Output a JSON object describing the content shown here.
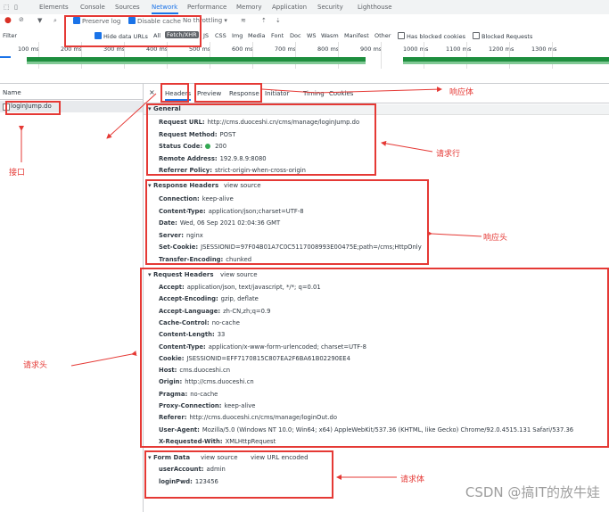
{
  "top_tabs": [
    "Elements",
    "Console",
    "Sources",
    "Network",
    "Performance",
    "Memory",
    "Application",
    "Security",
    "Lighthouse"
  ],
  "active_top_tab": "Network",
  "toolbar": {
    "preserve_log": "Preserve log",
    "disable_cache": "Disable cache",
    "throttling": "No throttling"
  },
  "filter": {
    "label": "Filter",
    "hide_data_urls": "Hide data URLs",
    "types": [
      "All",
      "Fetch/XHR",
      "JS",
      "CSS",
      "Img",
      "Media",
      "Font",
      "Doc",
      "WS",
      "Wasm",
      "Manifest",
      "Other"
    ],
    "selected_type": "Fetch/XHR",
    "blocked_cookies": "Has blocked cookies",
    "blocked_requests": "Blocked Requests"
  },
  "timeline_ticks": [
    "100 ms",
    "200 ms",
    "300 ms",
    "400 ms",
    "500 ms",
    "600 ms",
    "700 ms",
    "800 ms",
    "900 ms",
    "1000 ms",
    "1100 ms",
    "1200 ms",
    "1300 ms"
  ],
  "name_column": {
    "header": "Name",
    "request": "loginJump.do"
  },
  "detail_tabs": [
    "Headers",
    "Preview",
    "Response",
    "Initiator",
    "Timing",
    "Cookies"
  ],
  "active_detail_tab": "Headers",
  "view_source": "view source",
  "view_url_encoded": "view URL encoded",
  "general": {
    "title": "General",
    "rows": [
      {
        "k": "Request URL:",
        "v": "http://cms.duoceshi.cn/cms/manage/loginJump.do"
      },
      {
        "k": "Request Method:",
        "v": "POST"
      },
      {
        "k": "Status Code:",
        "v": "200"
      },
      {
        "k": "Remote Address:",
        "v": "192.9.8.9:8080"
      },
      {
        "k": "Referrer Policy:",
        "v": "strict-origin-when-cross-origin"
      }
    ]
  },
  "response_headers": {
    "title": "Response Headers",
    "rows": [
      {
        "k": "Connection:",
        "v": "keep-alive"
      },
      {
        "k": "Content-Type:",
        "v": "application/json;charset=UTF-8"
      },
      {
        "k": "Date:",
        "v": "Wed, 06 Sep 2021 02:04:36 GMT"
      },
      {
        "k": "Server:",
        "v": "nginx"
      },
      {
        "k": "Set-Cookie:",
        "v": "JSESSIONID=97F04B01A7C0C5117008993E00475E;path=/cms;HttpOnly"
      },
      {
        "k": "Transfer-Encoding:",
        "v": "chunked"
      }
    ]
  },
  "request_headers": {
    "title": "Request Headers",
    "rows": [
      {
        "k": "Accept:",
        "v": "application/json, text/javascript, */*; q=0.01"
      },
      {
        "k": "Accept-Encoding:",
        "v": "gzip, deflate"
      },
      {
        "k": "Accept-Language:",
        "v": "zh-CN,zh;q=0.9"
      },
      {
        "k": "Cache-Control:",
        "v": "no-cache"
      },
      {
        "k": "Content-Length:",
        "v": "33"
      },
      {
        "k": "Content-Type:",
        "v": "application/x-www-form-urlencoded; charset=UTF-8"
      },
      {
        "k": "Cookie:",
        "v": "JSESSIONID=EFF7170815C807EA2F6BA61B02290EE4"
      },
      {
        "k": "Host:",
        "v": "cms.duoceshi.cn"
      },
      {
        "k": "Origin:",
        "v": "http://cms.duoceshi.cn"
      },
      {
        "k": "Pragma:",
        "v": "no-cache"
      },
      {
        "k": "Proxy-Connection:",
        "v": "keep-alive"
      },
      {
        "k": "Referer:",
        "v": "http://cms.duoceshi.cn/cms/manage/loginOut.do"
      },
      {
        "k": "User-Agent:",
        "v": "Mozilla/5.0 (Windows NT 10.0; Win64; x64) AppleWebKit/537.36 (KHTML, like Gecko) Chrome/92.0.4515.131 Safari/537.36"
      },
      {
        "k": "X-Requested-With:",
        "v": "XMLHttpRequest"
      }
    ]
  },
  "form_data": {
    "title": "Form Data",
    "rows": [
      {
        "k": "userAccount:",
        "v": "admin"
      },
      {
        "k": "loginPwd:",
        "v": "123456"
      }
    ]
  },
  "annotations": {
    "interface": "接口",
    "response_body": "响应体",
    "request_line": "请求行",
    "response_headers": "响应头",
    "request_headers": "请求头",
    "request_body": "请求体"
  },
  "watermark": "CSDN @搞IT的放牛娃",
  "colors": {
    "accent": "#1a73e8",
    "annotation": "#e53935",
    "status_ok": "#34a853"
  }
}
